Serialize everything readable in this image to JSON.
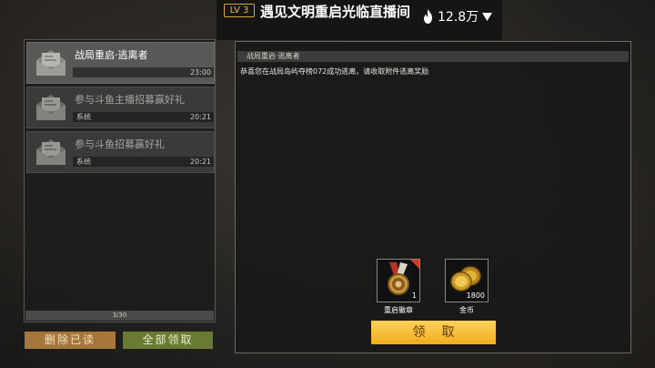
{
  "stream": {
    "level": "LV 3",
    "title": "遇见文明重启光临直播间",
    "heat": "12.8万",
    "icons": {
      "heat": "flame-icon",
      "menu": "dropdown-triangle-icon"
    }
  },
  "mail_list": {
    "items": [
      {
        "title": "战局重启·逃离者",
        "sender": "",
        "time": "23:00",
        "selected": true,
        "icon": "envelope-icon"
      },
      {
        "title": "参与斗鱼主播招募赢好礼",
        "sender": "系统",
        "time": "20:21",
        "selected": false,
        "icon": "envelope-icon"
      },
      {
        "title": "参与斗鱼招募赢好礼",
        "sender": "系统",
        "time": "20:21",
        "selected": false,
        "icon": "envelope-icon"
      }
    ],
    "page_counter": "3/30"
  },
  "actions": {
    "delete_read": "删除已读",
    "claim_all": "全部领取"
  },
  "detail": {
    "title": "战局重启·逃离者",
    "body": "恭喜您在战局岛屿夺榜072成功逃离，请收取附件逃离奖励",
    "rewards": [
      {
        "name": "重启徽章",
        "count": "1",
        "icon": "medal-icon",
        "new_marker": true
      },
      {
        "name": "金币",
        "count": "1800",
        "icon": "gold-coins-icon",
        "new_marker": false
      }
    ],
    "claim_button": "领取"
  },
  "colors": {
    "accent_gold": "#f0ad1e",
    "delete_button": "#a5773b",
    "claim_all_button": "#697a33",
    "level_badge": "#d9a43a"
  }
}
